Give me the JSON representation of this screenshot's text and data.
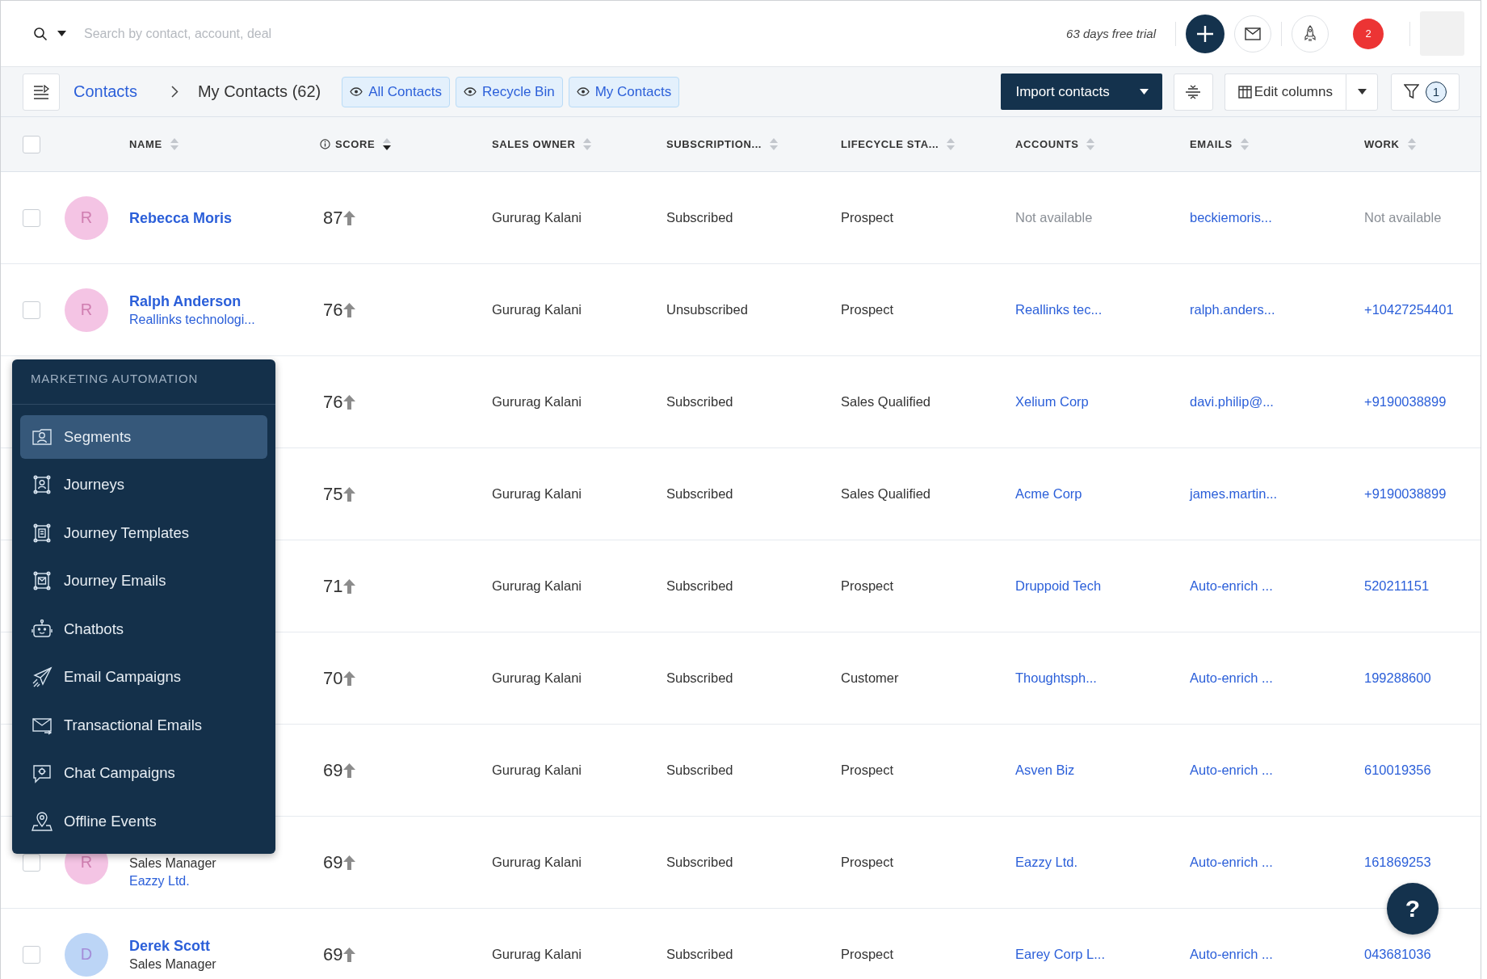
{
  "top_bar": {
    "search": {
      "placeholder": "Search by contact, account, deal"
    },
    "trial_text": "63 days free trial",
    "notifications": "2"
  },
  "toolbar": {
    "breadcrumb": {
      "parent": "Contacts",
      "current": "My Contacts (62)"
    },
    "views": [
      {
        "label": "All Contacts"
      },
      {
        "label": "Recycle Bin"
      },
      {
        "label": "My Contacts"
      }
    ],
    "import_button": "Import contacts",
    "edit_columns_button": "Edit columns",
    "filter_count": "1"
  },
  "table": {
    "select_all": {
      "checked": false
    },
    "columns": [
      {
        "label": "NAME",
        "sorted": false,
        "info": false
      },
      {
        "label": "SCORE",
        "sorted": true,
        "info": true
      },
      {
        "label": "SALES OWNER",
        "sorted": false,
        "info": false
      },
      {
        "label": "SUBSCRIPTION...",
        "sorted": false,
        "info": false
      },
      {
        "label": "LIFECYCLE STA...",
        "sorted": false,
        "info": false
      },
      {
        "label": "ACCOUNTS",
        "sorted": false,
        "info": false
      },
      {
        "label": "EMAILS",
        "sorted": false,
        "info": false
      },
      {
        "label": "WORK",
        "sorted": false,
        "info": false
      }
    ],
    "rows": [
      {
        "checked": false,
        "avatar": {
          "initial": "R",
          "color": "#f4c4e4"
        },
        "cells": [
          {
            "kind": "contact",
            "text": "Rebecca Moris"
          },
          {
            "kind": "score",
            "text": "87"
          },
          {
            "text": "Gururag Kalani",
            "kind": "text"
          },
          {
            "text": "Subscribed",
            "kind": "text"
          },
          {
            "text": "Prospect",
            "kind": "text"
          },
          {
            "text": "Not available",
            "kind": "muted"
          },
          {
            "text": "beckiemoris...",
            "kind": "link"
          },
          {
            "text": "Not available",
            "kind": "muted"
          }
        ]
      },
      {
        "checked": false,
        "avatar": {
          "initial": "R",
          "color": "#f4c4e4"
        },
        "cells": [
          {
            "kind": "contact",
            "text": "Ralph Anderson",
            "details": [
              {
                "text": "Reallinks technologi...",
                "kind": "link"
              }
            ]
          },
          {
            "kind": "score",
            "text": "76"
          },
          {
            "text": "Gururag Kalani",
            "kind": "text"
          },
          {
            "text": "Unsubscribed",
            "kind": "text"
          },
          {
            "text": "Prospect",
            "kind": "text"
          },
          {
            "text": "Reallinks tec...",
            "kind": "link"
          },
          {
            "text": "ralph.anders...",
            "kind": "link"
          },
          {
            "text": "+10427254401",
            "kind": "link"
          }
        ]
      },
      {
        "cells": [
          "",
          {
            "kind": "score",
            "text": "76"
          },
          {
            "text": "Gururag Kalani",
            "kind": "text"
          },
          {
            "text": "Subscribed",
            "kind": "text"
          },
          {
            "text": "Sales Qualified",
            "kind": "text"
          },
          {
            "text": "Xelium Corp",
            "kind": "link"
          },
          {
            "text": "davi.philip@...",
            "kind": "link"
          },
          {
            "text": "+9190038899",
            "kind": "link"
          }
        ]
      },
      {
        "cells": [
          "",
          {
            "kind": "score",
            "text": "75"
          },
          {
            "text": "Gururag Kalani",
            "kind": "text"
          },
          {
            "text": "Subscribed",
            "kind": "text"
          },
          {
            "text": "Sales Qualified",
            "kind": "text"
          },
          {
            "text": "Acme Corp",
            "kind": "link"
          },
          {
            "text": "james.martin...",
            "kind": "link"
          },
          {
            "text": "+9190038899",
            "kind": "link"
          }
        ]
      },
      {
        "cells": [
          "",
          {
            "kind": "score",
            "text": "71"
          },
          {
            "text": "Gururag Kalani",
            "kind": "text"
          },
          {
            "text": "Subscribed",
            "kind": "text"
          },
          {
            "text": "Prospect",
            "kind": "text"
          },
          {
            "text": "Druppoid Tech",
            "kind": "link"
          },
          {
            "text": "Auto-enrich ...",
            "kind": "link"
          },
          {
            "text": "520211151",
            "kind": "link"
          }
        ]
      },
      {
        "cells": [
          "",
          {
            "kind": "score",
            "text": "70"
          },
          {
            "text": "Gururag Kalani",
            "kind": "text"
          },
          {
            "text": "Subscribed",
            "kind": "text"
          },
          {
            "text": "Customer",
            "kind": "text"
          },
          {
            "text": "Thoughtsph...",
            "kind": "link"
          },
          {
            "text": "Auto-enrich ...",
            "kind": "link"
          },
          {
            "text": "199288600",
            "kind": "link"
          }
        ]
      },
      {
        "cells": [
          "",
          {
            "kind": "score",
            "text": "69"
          },
          {
            "text": "Gururag Kalani",
            "kind": "text"
          },
          {
            "text": "Subscribed",
            "kind": "text"
          },
          {
            "text": "Prospect",
            "kind": "text"
          },
          {
            "text": "Asven Biz",
            "kind": "link"
          },
          {
            "text": "Auto-enrich ...",
            "kind": "link"
          },
          {
            "text": "610019356",
            "kind": "link"
          }
        ]
      },
      {
        "checked": false,
        "avatar": {
          "initial": "R",
          "color": "#f4c4e4"
        },
        "cells": [
          {
            "kind": "contact",
            "details": [
              {
                "text": "Sales Manager",
                "kind": "text"
              },
              {
                "text": "Eazzy Ltd.",
                "kind": "link"
              }
            ]
          },
          {
            "kind": "score",
            "text": "69"
          },
          {
            "text": "Gururag Kalani",
            "kind": "text"
          },
          {
            "text": "Subscribed",
            "kind": "text"
          },
          {
            "text": "Prospect",
            "kind": "text"
          },
          {
            "text": "Eazzy Ltd.",
            "kind": "link"
          },
          {
            "text": "Auto-enrich ...",
            "kind": "link"
          },
          {
            "text": "161869253",
            "kind": "link"
          }
        ]
      },
      {
        "checked": false,
        "avatar": {
          "initial": "D",
          "color": "#bcd5f6"
        },
        "cells": [
          {
            "kind": "contact",
            "text": "Derek Scott",
            "details": [
              {
                "text": "Sales Manager",
                "kind": "text"
              }
            ]
          },
          {
            "kind": "score",
            "text": "69"
          },
          {
            "text": "Gururag Kalani",
            "kind": "text"
          },
          {
            "text": "Subscribed",
            "kind": "text"
          },
          {
            "text": "Prospect",
            "kind": "text"
          },
          {
            "text": "Earey Corp L...",
            "kind": "link"
          },
          {
            "text": "Auto-enrich ...",
            "kind": "link"
          },
          {
            "text": "043681036",
            "kind": "link"
          }
        ]
      }
    ]
  },
  "menu": {
    "title": "MARKETING AUTOMATION",
    "items": [
      {
        "label": "Segments",
        "selected": true
      },
      {
        "label": "Journeys",
        "selected": false
      },
      {
        "label": "Journey Templates",
        "selected": false
      },
      {
        "label": "Journey Emails",
        "selected": false
      },
      {
        "label": "Chatbots",
        "selected": false
      },
      {
        "label": "Email Campaigns",
        "selected": false
      },
      {
        "label": "Transactional Emails",
        "selected": false
      },
      {
        "label": "Chat Campaigns",
        "selected": false
      },
      {
        "label": "Offline Events",
        "selected": false
      }
    ]
  },
  "help_button": {
    "label": "?"
  }
}
